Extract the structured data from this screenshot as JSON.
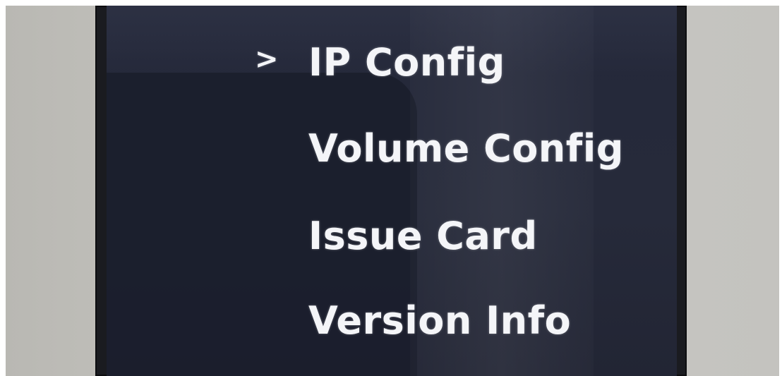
{
  "menu": {
    "cursor_glyph": ">",
    "selected_index": 0,
    "items": [
      {
        "label": "IP Config"
      },
      {
        "label": "Volume Config"
      },
      {
        "label": "Issue Card"
      },
      {
        "label": "Version Info"
      }
    ]
  },
  "colors": {
    "screen_background": "#24283a",
    "text": "#f4f5f8",
    "bezel": "#1a1b20",
    "wall": "#c4c3bf"
  }
}
